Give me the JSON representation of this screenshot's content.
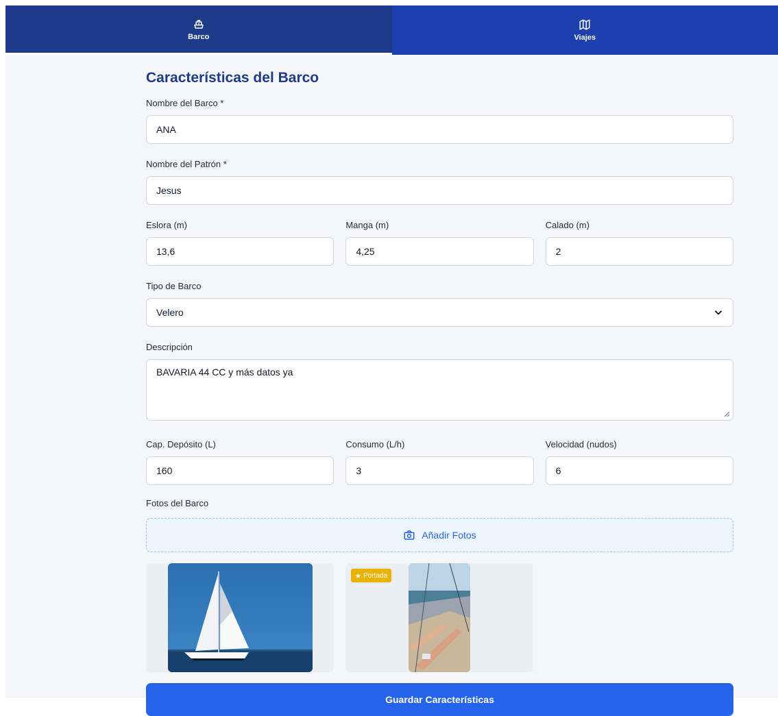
{
  "tabs": {
    "barco": {
      "label": "Barco",
      "icon": "ship-icon",
      "active": true
    },
    "viajes": {
      "label": "Viajes",
      "icon": "map-icon",
      "active": false
    }
  },
  "form": {
    "title": "Características del Barco",
    "boat_name": {
      "label": "Nombre del Barco *",
      "value": "ANA"
    },
    "skipper_name": {
      "label": "Nombre del Patrón *",
      "value": "Jesus"
    },
    "eslora": {
      "label": "Eslora (m)",
      "value": "13,6"
    },
    "manga": {
      "label": "Manga (m)",
      "value": "4,25"
    },
    "calado": {
      "label": "Calado (m)",
      "value": "2"
    },
    "boat_type": {
      "label": "Tipo de Barco",
      "value": "Velero"
    },
    "description": {
      "label": "Descripción",
      "value": "BAVARIA 44 CC y más datos ya"
    },
    "tank": {
      "label": "Cap. Depósito (L)",
      "value": "160"
    },
    "consumption": {
      "label": "Consumo (L/h)",
      "value": "3"
    },
    "speed": {
      "label": "Velocidad (nudos)",
      "value": "6"
    },
    "photos": {
      "label": "Fotos del Barco",
      "add_label": "Añadir Fotos",
      "cover_badge": "Portada"
    },
    "save_label": "Guardar Características"
  },
  "colors": {
    "primary": "#2563eb",
    "nav_dark": "#1e3a8a",
    "badge": "#eab308"
  }
}
